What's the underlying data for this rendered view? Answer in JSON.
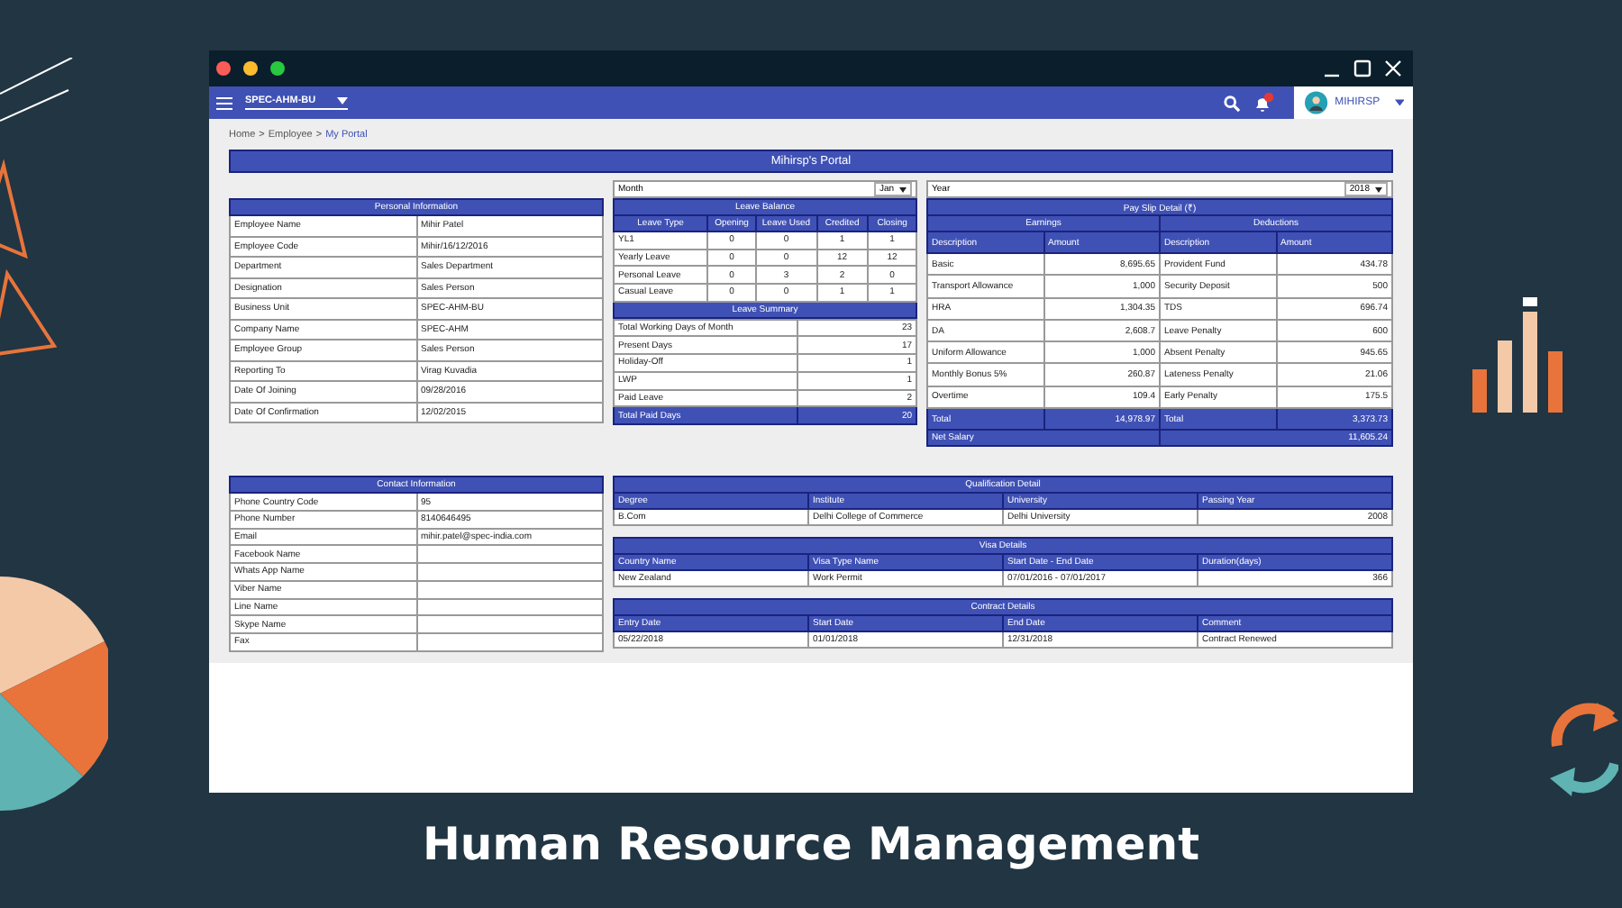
{
  "app_bar": {
    "business_unit": "SPEC-AHM-BU",
    "user": "MIHIRSP"
  },
  "breadcrumb": {
    "separator": ">",
    "items": [
      {
        "label": "Home",
        "selected": false
      },
      {
        "label": "Employee",
        "selected": false
      },
      {
        "label": "My Portal",
        "selected": true
      }
    ]
  },
  "portal_title": "Mihirsp's Portal",
  "personal_info": {
    "title": "Personal Information",
    "rows": [
      {
        "label": "Employee Name",
        "value": "Mihir Patel"
      },
      {
        "label": "Employee Code",
        "value": "Mihir/16/12/2016"
      },
      {
        "label": "Department",
        "value": "Sales Department"
      },
      {
        "label": "Designation",
        "value": "Sales Person"
      },
      {
        "label": "Business Unit",
        "value": "SPEC-AHM-BU"
      },
      {
        "label": "Company Name",
        "value": "SPEC-AHM"
      },
      {
        "label": "Employee Group",
        "value": "Sales Person"
      },
      {
        "label": "Reporting To",
        "value": "Virag Kuvadia"
      },
      {
        "label": "Date Of Joining",
        "value": "09/28/2016"
      },
      {
        "label": "Date Of Confirmation",
        "value": "12/02/2015"
      }
    ]
  },
  "month": {
    "label": "Month",
    "value": "Jan"
  },
  "leave_balance": {
    "title": "Leave Balance",
    "columns": [
      "Leave Type",
      "Opening",
      "Leave Used",
      "Credited",
      "Closing"
    ],
    "rows": [
      [
        "YL1",
        "0",
        "0",
        "1",
        "1"
      ],
      [
        "Yearly Leave",
        "0",
        "0",
        "12",
        "12"
      ],
      [
        "Personal Leave",
        "0",
        "3",
        "2",
        "0"
      ],
      [
        "Casual Leave",
        "0",
        "0",
        "1",
        "1"
      ]
    ]
  },
  "leave_summary": {
    "title": "Leave Summary",
    "rows": [
      {
        "label": "Total Working Days of Month",
        "value": "23",
        "kind": "item"
      },
      {
        "label": "Present Days",
        "value": "17",
        "kind": "item"
      },
      {
        "label": "Holiday-Off",
        "value": "1",
        "kind": "item"
      },
      {
        "label": "LWP",
        "value": "1",
        "kind": "item"
      },
      {
        "label": "Paid Leave",
        "value": "2",
        "kind": "item"
      },
      {
        "label": "Total Paid Days",
        "value": "20",
        "kind": "total"
      }
    ]
  },
  "year": {
    "label": "Year",
    "value": "2018"
  },
  "pay_slip": {
    "title": "Pay Slip Detail (₹)",
    "earnings_label": "Earnings",
    "deductions_label": "Deductions",
    "columns": [
      "Description",
      "Amount",
      "Description",
      "Amount"
    ],
    "rows": [
      [
        "Basic",
        "8,695.65",
        "Provident Fund",
        "434.78"
      ],
      [
        "Transport Allowance",
        "1,000",
        "Security Deposit",
        "500"
      ],
      [
        "HRA",
        "1,304.35",
        "TDS",
        "696.74"
      ],
      [
        "DA",
        "2,608.7",
        "Leave Penalty",
        "600"
      ],
      [
        "Uniform Allowance",
        "1,000",
        "Absent Penalty",
        "945.65"
      ],
      [
        "Monthly Bonus 5%",
        "260.87",
        "Lateness Penalty",
        "21.06"
      ],
      [
        "Overtime",
        "109.4",
        "Early Penalty",
        "175.5"
      ]
    ],
    "total": [
      "Total",
      "14,978.97",
      "Total",
      "3,373.73"
    ],
    "net_salary": {
      "label": "Net Salary",
      "amount": "11,605.24"
    }
  },
  "contact_info": {
    "title": "Contact Information",
    "rows": [
      {
        "label": "Phone Country Code",
        "value": "95"
      },
      {
        "label": "Phone Number",
        "value": "8140646495"
      },
      {
        "label": "Email",
        "value": "mihir.patel@spec-india.com"
      },
      {
        "label": "Facebook Name"
      },
      {
        "label": "Whats App Name"
      },
      {
        "label": "Viber Name"
      },
      {
        "label": "Line Name"
      },
      {
        "label": "Skype Name"
      },
      {
        "label": "Fax"
      }
    ]
  },
  "detail_tables": [
    {
      "title": "Qualification Detail",
      "columns": [
        {
          "label": "Degree",
          "numeric": false
        },
        {
          "label": "Institute",
          "numeric": false
        },
        {
          "label": "University",
          "numeric": false
        },
        {
          "label": "Passing Year",
          "numeric": true
        }
      ],
      "rows": [
        [
          "B.Com",
          "Delhi College of Commerce",
          "Delhi University",
          "2008"
        ]
      ]
    },
    {
      "title": "Visa Details",
      "columns": [
        {
          "label": "Country Name",
          "numeric": false
        },
        {
          "label": "Visa Type Name",
          "numeric": false
        },
        {
          "label": "Start Date - End Date",
          "numeric": false
        },
        {
          "label": "Duration(days)",
          "numeric": true
        }
      ],
      "rows": [
        [
          "New Zealand",
          "Work Permit",
          "07/01/2016 - 07/01/2017",
          "366"
        ]
      ]
    },
    {
      "title": "Contract Details",
      "columns": [
        {
          "label": "Entry Date",
          "numeric": false
        },
        {
          "label": "Start Date",
          "numeric": false
        },
        {
          "label": "End Date",
          "numeric": false
        },
        {
          "label": "Comment",
          "numeric": false
        }
      ],
      "rows": [
        [
          "05/22/2018",
          "01/01/2018",
          "12/31/2018",
          "Contract Renewed"
        ]
      ]
    }
  ],
  "caption": "Human Resource Management"
}
